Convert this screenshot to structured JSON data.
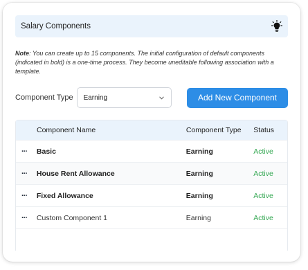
{
  "banner": {
    "title": "Salary Components",
    "icon": "lightbulb-icon"
  },
  "note": {
    "label": "Note",
    "text": ": You can create up to 15 components. The initial configuration of default components (indicated in bold) is a one-time process. They become uneditable following association with a template."
  },
  "filter": {
    "label": "Component Type",
    "selected": "Earning"
  },
  "add_button_label": "Add New Component",
  "table": {
    "headers": [
      "Component Name",
      "Component Type",
      "Status"
    ],
    "rows": [
      {
        "actions": "···",
        "name": "Basic",
        "type": "Earning",
        "status": "Active",
        "bold": true
      },
      {
        "actions": "···",
        "name": "House Rent Allowance",
        "type": "Earning",
        "status": "Active",
        "bold": true
      },
      {
        "actions": "···",
        "name": "Fixed Allowance",
        "type": "Earning",
        "status": "Active",
        "bold": true
      },
      {
        "actions": "···",
        "name": "Custom Component 1",
        "type": "Earning",
        "status": "Active",
        "bold": false
      }
    ]
  },
  "colors": {
    "accent": "#2d8de6",
    "status_active": "#35a853",
    "header_bg": "#eaf3fc"
  }
}
